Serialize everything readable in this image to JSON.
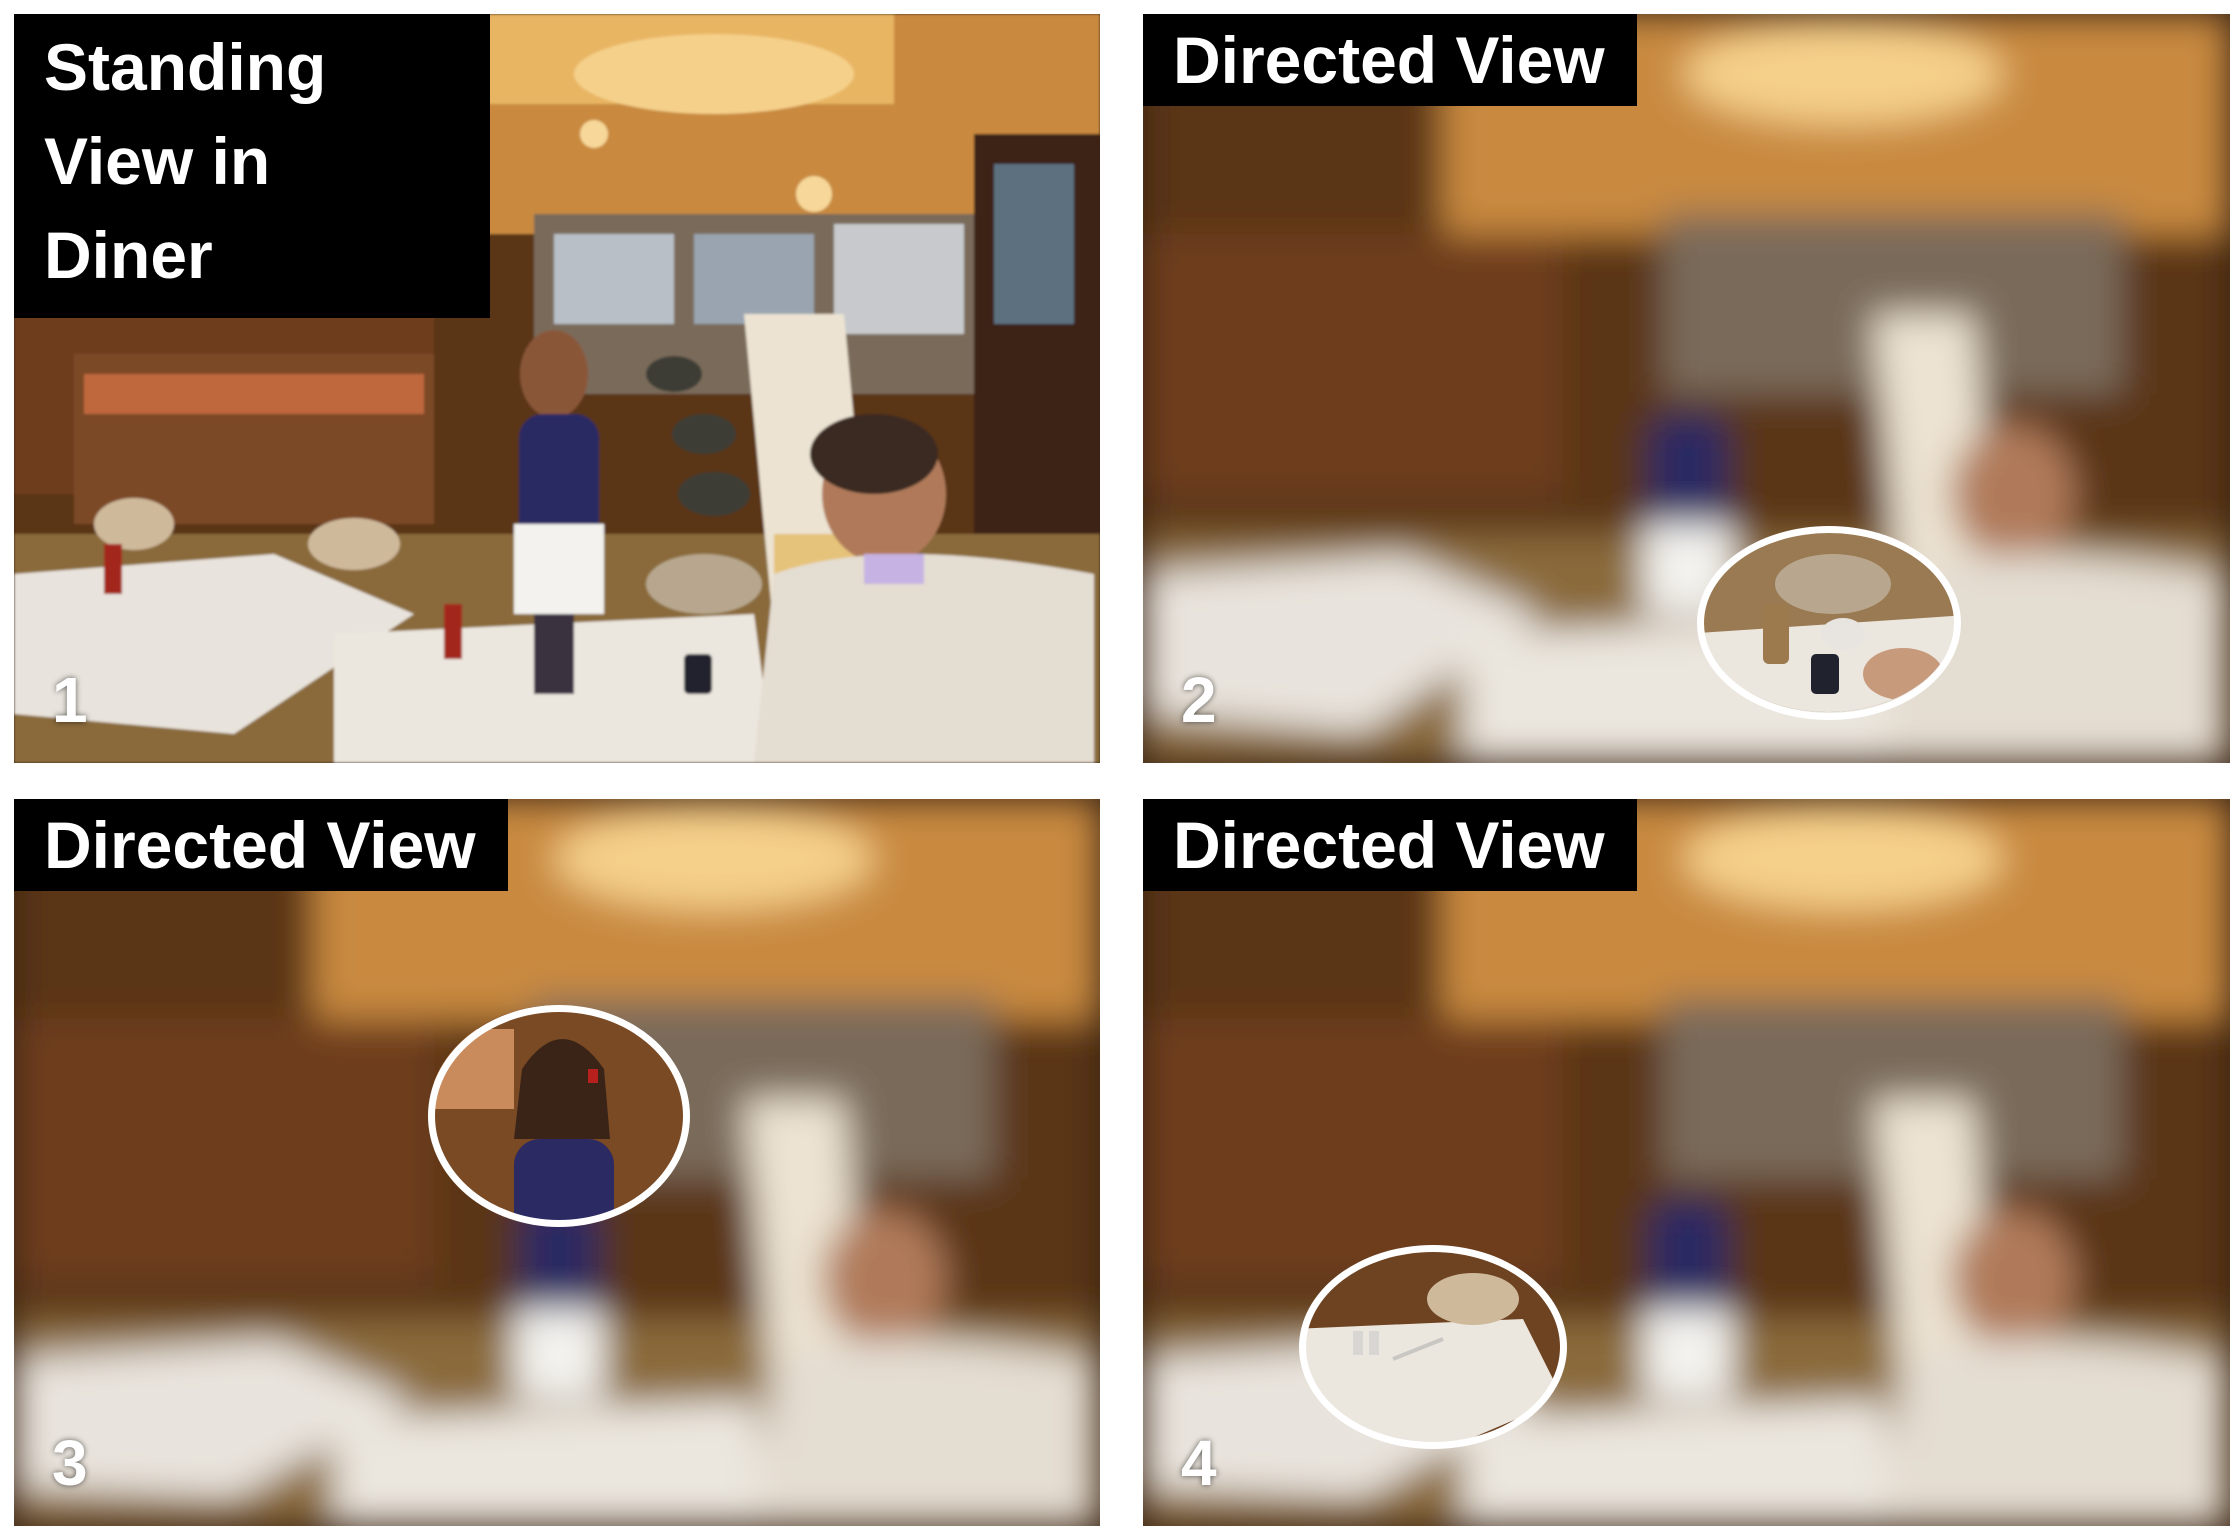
{
  "panels": [
    {
      "number": "1",
      "caption": "Standing View in Diner",
      "focus": false
    },
    {
      "number": "2",
      "caption": "Directed View",
      "focus": true
    },
    {
      "number": "3",
      "caption": "Directed View",
      "focus": true
    },
    {
      "number": "4",
      "caption": "Directed View",
      "focus": true
    }
  ],
  "colors": {
    "caption_bg": "#000000",
    "caption_text": "#ffffff",
    "ring": "#ffffff",
    "warm_light": "#f2b35a",
    "wood": "#6b3d1f",
    "table_top": "#e9e4dd",
    "uniform": "#2b2a63"
  }
}
